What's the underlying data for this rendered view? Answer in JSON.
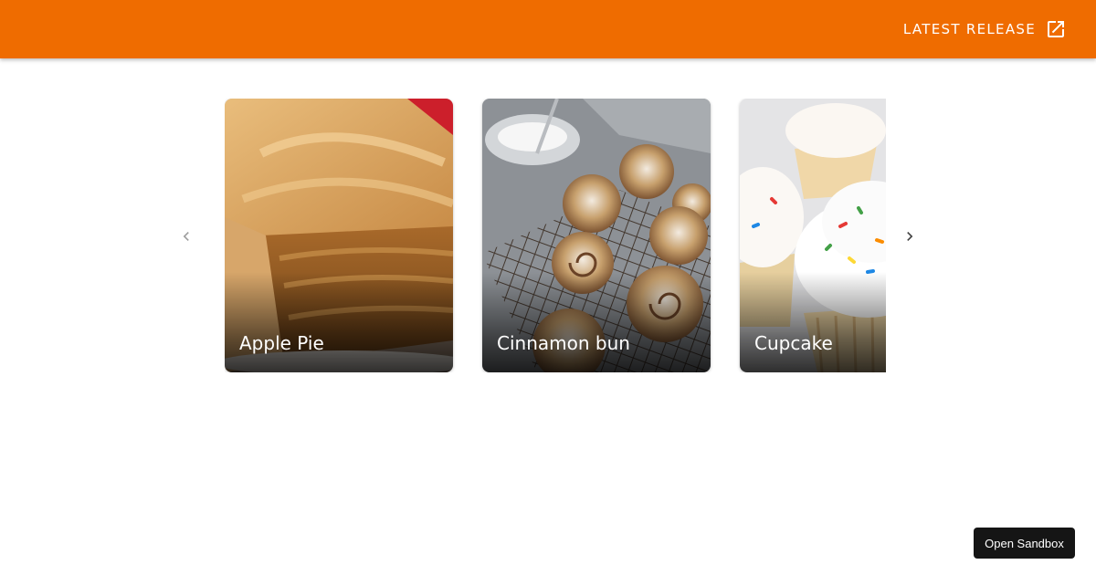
{
  "header": {
    "link_label": "LATEST RELEASE",
    "link_icon": "open-in-new-icon",
    "color": "#ef6c00"
  },
  "carousel": {
    "prev_icon": "chevron-left-icon",
    "next_icon": "chevron-right-icon",
    "cards": [
      {
        "title": "Apple Pie"
      },
      {
        "title": "Cinnamon bun"
      },
      {
        "title": "Cupcake"
      }
    ]
  },
  "sandbox": {
    "label": "Open Sandbox"
  }
}
